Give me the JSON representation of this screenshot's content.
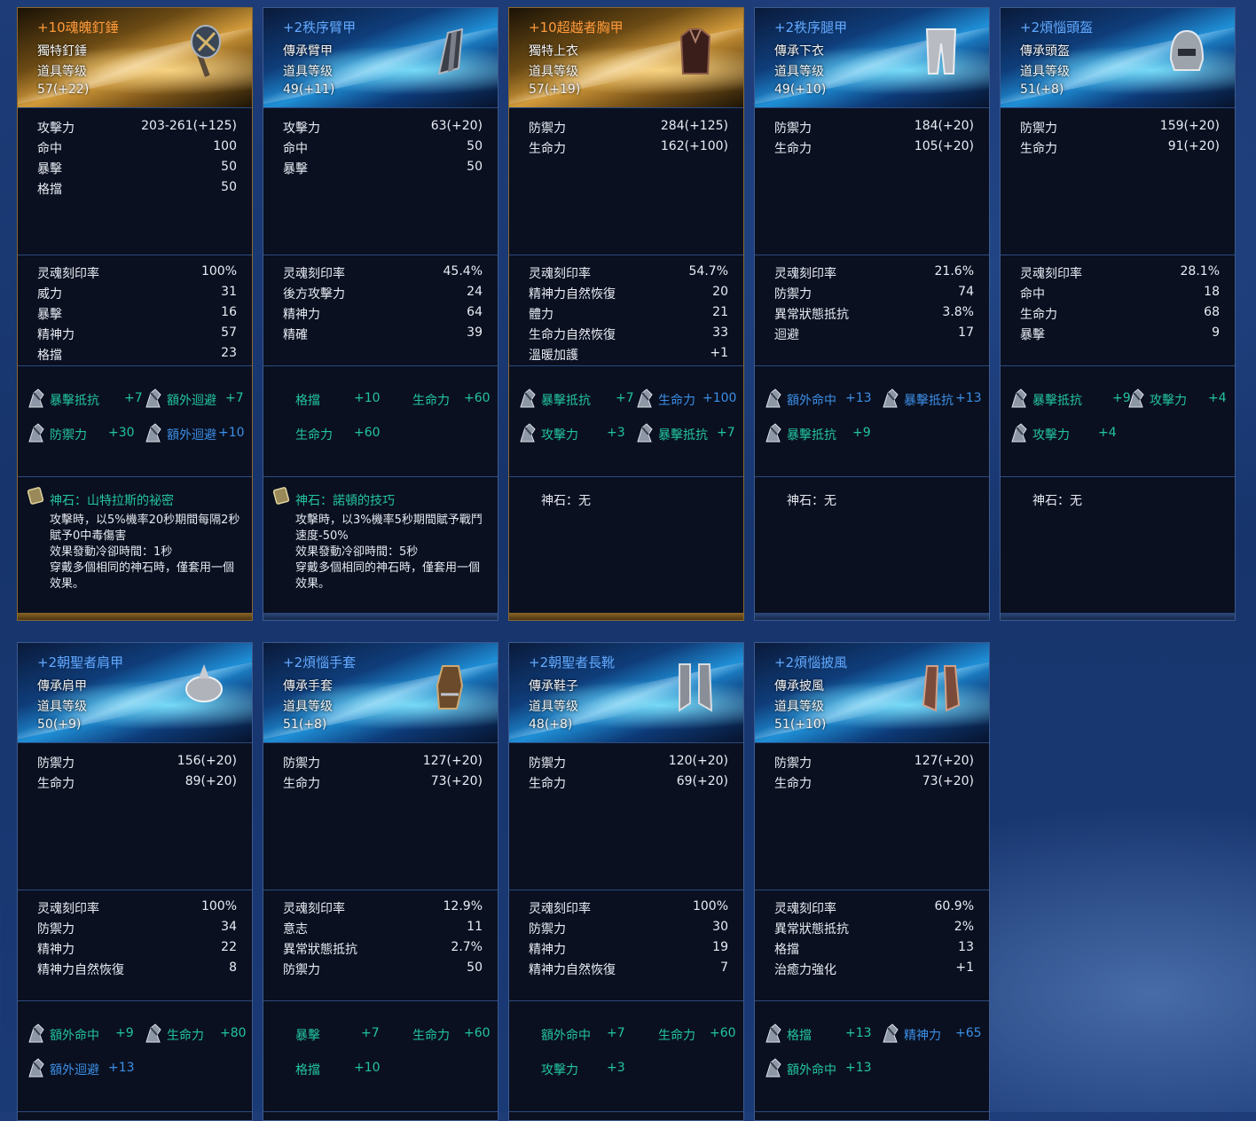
{
  "labels": {
    "item_level": "道具等级",
    "soul_rate": "灵魂刻印率"
  },
  "items": [
    {
      "name": "+10魂魄釘錘",
      "category": "獨特釘錘",
      "level": "57(+22)",
      "stats": [
        {
          "k": "攻擊力",
          "v": "203-261(+125)"
        },
        {
          "k": "命中",
          "v": "100"
        },
        {
          "k": "暴擊",
          "v": "50"
        },
        {
          "k": "格擋",
          "v": "50"
        }
      ],
      "soul_rate": "100%",
      "soul": [
        {
          "k": "威力",
          "v": "31"
        },
        {
          "k": "暴擊",
          "v": "16"
        },
        {
          "k": "精神力",
          "v": "57"
        },
        {
          "k": "格擋",
          "v": "23"
        }
      ],
      "gems": [
        {
          "label": "暴擊抵抗",
          "value": "+7",
          "color": "teal",
          "icon": true
        },
        {
          "label": "額外迴避",
          "value": "+7",
          "color": "teal",
          "icon": true
        },
        {
          "label": "防禦力",
          "value": "+30",
          "color": "teal",
          "icon": true
        },
        {
          "label": "額外迴避",
          "value": "+10",
          "color": "blue",
          "icon": true
        }
      ],
      "stone": {
        "title": "神石：山特拉斯的祕密",
        "desc": [
          "攻擊時，以5%機率20秒期間每隔2秒賦予0中毒傷害",
          "效果發動冷卻時間：1秒",
          "穿戴多個相同的神石時，僅套用一個效果。"
        ],
        "icon": true
      }
    },
    {
      "name": "+2秩序臂甲",
      "category": "傳承臂甲",
      "level": "49(+11)",
      "stats": [
        {
          "k": "攻擊力",
          "v": "63(+20)"
        },
        {
          "k": "命中",
          "v": "50"
        },
        {
          "k": "暴擊",
          "v": "50"
        }
      ],
      "soul_rate": "45.4%",
      "soul": [
        {
          "k": "後方攻擊力",
          "v": "24"
        },
        {
          "k": "精神力",
          "v": "64"
        },
        {
          "k": "精確",
          "v": "39"
        }
      ],
      "gems": [
        {
          "label": "格擋",
          "value": "+10",
          "color": "teal",
          "icon": false
        },
        {
          "label": "生命力",
          "value": "+60",
          "color": "teal",
          "icon": false
        },
        {
          "label": "生命力",
          "value": "+60",
          "color": "teal",
          "icon": false
        }
      ],
      "stone": {
        "title": "神石：諾頓的技巧",
        "desc": [
          "攻擊時，以3%機率5秒期間賦予戰鬥速度-50%",
          "效果發動冷卻時間：5秒",
          "穿戴多個相同的神石時，僅套用一個效果。"
        ],
        "icon": true
      }
    },
    {
      "name": "+10超越者胸甲",
      "category": "獨特上衣",
      "level": "57(+19)",
      "stats": [
        {
          "k": "防禦力",
          "v": "284(+125)"
        },
        {
          "k": "生命力",
          "v": "162(+100)"
        }
      ],
      "soul_rate": "54.7%",
      "soul": [
        {
          "k": "精神力自然恢復",
          "v": "20"
        },
        {
          "k": "體力",
          "v": "21"
        },
        {
          "k": "生命力自然恢復",
          "v": "33"
        },
        {
          "k": "溫暖加護",
          "v": "+1"
        }
      ],
      "gems": [
        {
          "label": "暴擊抵抗",
          "value": "+7",
          "color": "teal",
          "icon": true
        },
        {
          "label": "生命力",
          "value": "+100",
          "color": "blue",
          "icon": true
        },
        {
          "label": "攻擊力",
          "value": "+3",
          "color": "teal",
          "icon": true
        },
        {
          "label": "暴擊抵抗",
          "value": "+7",
          "color": "teal",
          "icon": true
        }
      ],
      "stone": {
        "title": "神石：无",
        "desc": [],
        "icon": false
      }
    },
    {
      "name": "+2秩序腿甲",
      "category": "傳承下衣",
      "level": "49(+10)",
      "stats": [
        {
          "k": "防禦力",
          "v": "184(+20)"
        },
        {
          "k": "生命力",
          "v": "105(+20)"
        }
      ],
      "soul_rate": "21.6%",
      "soul": [
        {
          "k": "防禦力",
          "v": "74"
        },
        {
          "k": "異常狀態抵抗",
          "v": "3.8%"
        },
        {
          "k": "迴避",
          "v": "17"
        }
      ],
      "gems": [
        {
          "label": "額外命中",
          "value": "+13",
          "color": "blue",
          "icon": true
        },
        {
          "label": "暴擊抵抗",
          "value": "+13",
          "color": "blue",
          "icon": true
        },
        {
          "label": "暴擊抵抗",
          "value": "+9",
          "color": "teal",
          "icon": true
        }
      ],
      "stone": {
        "title": "神石：无",
        "desc": [],
        "icon": false
      }
    },
    {
      "name": "+2煩惱頭盔",
      "category": "傳承頭盔",
      "level": "51(+8)",
      "stats": [
        {
          "k": "防禦力",
          "v": "159(+20)"
        },
        {
          "k": "生命力",
          "v": "91(+20)"
        }
      ],
      "soul_rate": "28.1%",
      "soul": [
        {
          "k": "命中",
          "v": "18"
        },
        {
          "k": "生命力",
          "v": "68"
        },
        {
          "k": "暴擊",
          "v": "9"
        }
      ],
      "gems": [
        {
          "label": "暴擊抵抗",
          "value": "+9",
          "color": "teal",
          "icon": true
        },
        {
          "label": "攻擊力",
          "value": "+4",
          "color": "teal",
          "icon": true
        },
        {
          "label": "攻擊力",
          "value": "+4",
          "color": "teal",
          "icon": true
        }
      ],
      "stone": {
        "title": "神石：无",
        "desc": [],
        "icon": false
      }
    },
    {
      "name": "+2朝聖者肩甲",
      "category": "傳承肩甲",
      "level": "50(+9)",
      "stats": [
        {
          "k": "防禦力",
          "v": "156(+20)"
        },
        {
          "k": "生命力",
          "v": "89(+20)"
        }
      ],
      "soul_rate": "100%",
      "soul": [
        {
          "k": "防禦力",
          "v": "34"
        },
        {
          "k": "精神力",
          "v": "22"
        },
        {
          "k": "精神力自然恢復",
          "v": "8"
        }
      ],
      "gems": [
        {
          "label": "額外命中",
          "value": "+9",
          "color": "teal",
          "icon": true
        },
        {
          "label": "生命力",
          "value": "+80",
          "color": "teal",
          "icon": true
        },
        {
          "label": "額外迴避",
          "value": "+13",
          "color": "blue",
          "icon": true
        }
      ]
    },
    {
      "name": "+2煩惱手套",
      "category": "傳承手套",
      "level": "51(+8)",
      "stats": [
        {
          "k": "防禦力",
          "v": "127(+20)"
        },
        {
          "k": "生命力",
          "v": "73(+20)"
        }
      ],
      "soul_rate": "12.9%",
      "soul": [
        {
          "k": "意志",
          "v": "11"
        },
        {
          "k": "異常狀態抵抗",
          "v": "2.7%"
        },
        {
          "k": "防禦力",
          "v": "50"
        }
      ],
      "gems": [
        {
          "label": "暴擊",
          "value": "+7",
          "color": "teal",
          "icon": false
        },
        {
          "label": "生命力",
          "value": "+60",
          "color": "teal",
          "icon": false
        },
        {
          "label": "格擋",
          "value": "+10",
          "color": "teal",
          "icon": false
        }
      ]
    },
    {
      "name": "+2朝聖者長靴",
      "category": "傳承鞋子",
      "level": "48(+8)",
      "stats": [
        {
          "k": "防禦力",
          "v": "120(+20)"
        },
        {
          "k": "生命力",
          "v": "69(+20)"
        }
      ],
      "soul_rate": "100%",
      "soul": [
        {
          "k": "防禦力",
          "v": "30"
        },
        {
          "k": "精神力",
          "v": "19"
        },
        {
          "k": "精神力自然恢復",
          "v": "7"
        }
      ],
      "gems": [
        {
          "label": "額外命中",
          "value": "+7",
          "color": "teal",
          "icon": false
        },
        {
          "label": "生命力",
          "value": "+60",
          "color": "teal",
          "icon": false
        },
        {
          "label": "攻擊力",
          "value": "+3",
          "color": "teal",
          "icon": false
        }
      ]
    },
    {
      "name": "+2煩惱披風",
      "category": "傳承披風",
      "level": "51(+10)",
      "stats": [
        {
          "k": "防禦力",
          "v": "127(+20)"
        },
        {
          "k": "生命力",
          "v": "73(+20)"
        }
      ],
      "soul_rate": "60.9%",
      "soul": [
        {
          "k": "異常狀態抵抗",
          "v": "2%"
        },
        {
          "k": "格擋",
          "v": "13"
        },
        {
          "k": "治癒力強化",
          "v": "+1"
        }
      ],
      "gems": [
        {
          "label": "格擋",
          "value": "+13",
          "color": "teal",
          "icon": true
        },
        {
          "label": "精神力",
          "value": "+65",
          "color": "blue",
          "icon": true
        },
        {
          "label": "額外命中",
          "value": "+13",
          "color": "teal",
          "icon": true
        }
      ]
    }
  ]
}
